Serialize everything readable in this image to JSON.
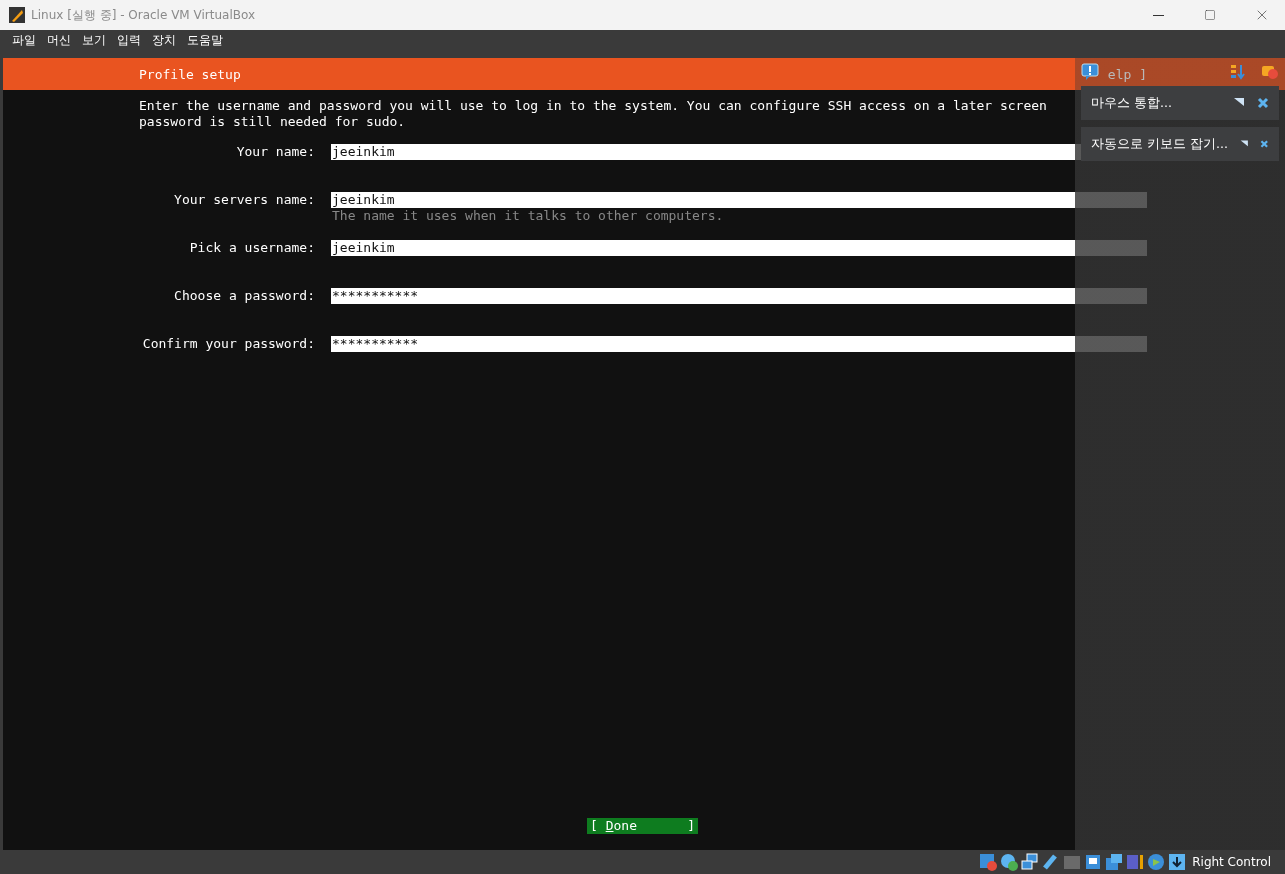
{
  "window": {
    "title": "Linux [실행 중] - Oracle VM VirtualBox"
  },
  "menu": [
    "파일",
    "머신",
    "보기",
    "입력",
    "장치",
    "도움말"
  ],
  "installer": {
    "header": "Profile setup",
    "help": "elp ]",
    "intro": [
      "Enter the username and password you will use to log in to the system. You can configure SSH access on a later screen",
      "password is still needed for sudo."
    ],
    "fields": [
      {
        "label": "Your name:",
        "value": "jeeinkim"
      },
      {
        "label": "Your servers name:",
        "value": "jeeinkim",
        "hint": "The name it uses when it talks to other computers."
      },
      {
        "label": "Pick a username:",
        "value": "jeeinkim"
      },
      {
        "label": "Choose a password:",
        "value": "***********"
      },
      {
        "label": "Confirm your password:",
        "value": "***********"
      }
    ],
    "done": {
      "open": "[",
      "label": "Done",
      "close": "]"
    }
  },
  "notifications": [
    "마우스 통합...",
    "자동으로 키보드 잡기..."
  ],
  "status_bar": {
    "host_key": "Right Control"
  }
}
